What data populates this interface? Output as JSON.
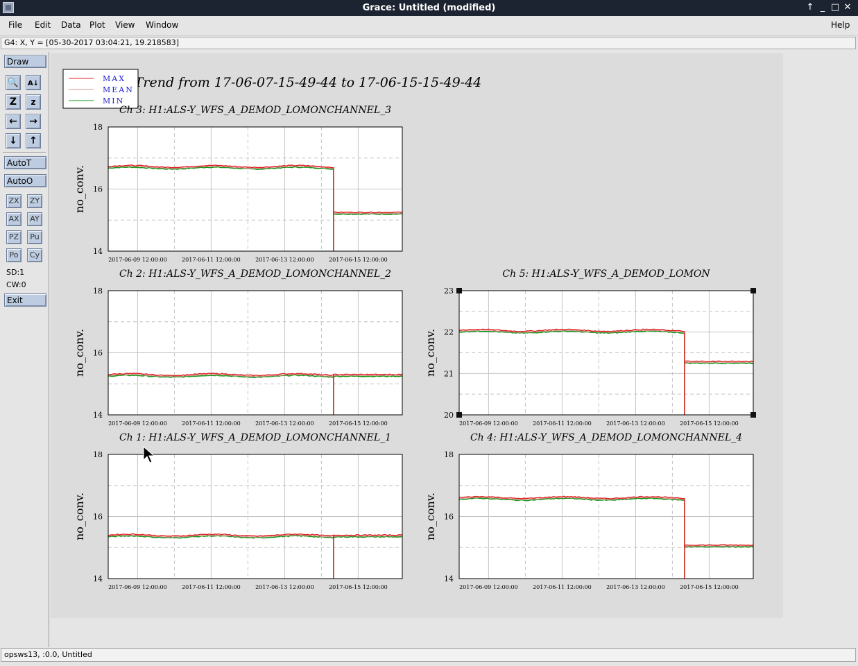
{
  "window": {
    "title": "Grace: Untitled (modified)"
  },
  "menu": {
    "items": [
      "File",
      "Edit",
      "Data",
      "Plot",
      "View",
      "Window"
    ],
    "help": "Help"
  },
  "coord_readout": "G4: X, Y = [05-30-2017 03:04:21, 19.218583]",
  "toolbar": {
    "draw": "Draw",
    "autot": "AutoT",
    "autoo": "AutoO",
    "small_buttons": [
      "ZX",
      "ZY",
      "AX",
      "AY",
      "PZ",
      "Pu",
      "Po",
      "Cy"
    ],
    "sd": "SD:1",
    "cw": "CW:0",
    "exit": "Exit"
  },
  "statusbar": "opsws13, :0.0, Untitled",
  "chart_data": {
    "type": "line",
    "title": "Trend from 17-06-07-15-49-44 to 17-06-15-15-49-44",
    "legend": {
      "placement": "top-left",
      "entries": [
        {
          "name": "MAX",
          "color": "#e02020"
        },
        {
          "name": "MEAN",
          "color": "#d89090"
        },
        {
          "name": "MIN",
          "color": "#16981a"
        }
      ]
    },
    "x_tick_labels": [
      "2017-06-09 12:00:00",
      "2017-06-11 12:00:00",
      "2017-06-13 12:00:00",
      "2017-06-15 12:00:00"
    ],
    "colors": {
      "max": "#e02020",
      "mean": "#d89090",
      "min": "#16981a",
      "grid": "#c4c4c4"
    },
    "panels": [
      {
        "id": "ch3",
        "title": "Ch 3: H1:ALS-Y_WFS_A_DEMOD_LOMONCHANNEL_3",
        "ylabel": "no_conv.",
        "ylim": [
          14,
          18
        ],
        "yticks": [
          "18",
          "16",
          "14"
        ],
        "level_before": 16.7,
        "level_after": 15.22,
        "drop": true
      },
      {
        "id": "ch2",
        "title": "Ch 2: H1:ALS-Y_WFS_A_DEMOD_LOMONCHANNEL_2",
        "ylabel": "no_conv.",
        "ylim": [
          14,
          18
        ],
        "yticks": [
          "18",
          "16",
          "14"
        ],
        "level_before": 15.27,
        "level_after": 15.27,
        "drop": true
      },
      {
        "id": "ch5",
        "title": "Ch 5: H1:ALS-Y_WFS_A_DEMOD_LOMON",
        "ylabel": "no_conv.",
        "ylim": [
          20,
          23
        ],
        "yticks": [
          "23",
          "22",
          "21",
          "20"
        ],
        "level_before": 22.02,
        "level_after": 21.27,
        "drop": true,
        "selected": true
      },
      {
        "id": "ch1",
        "title": "Ch 1: H1:ALS-Y_WFS_A_DEMOD_LOMONCHANNEL_1",
        "ylabel": "no_conv.",
        "ylim": [
          14,
          18
        ],
        "yticks": [
          "18",
          "16",
          "14"
        ],
        "level_before": 15.37,
        "level_after": 15.37,
        "drop": true
      },
      {
        "id": "ch4",
        "title": "Ch 4: H1:ALS-Y_WFS_A_DEMOD_LOMONCHANNEL_4",
        "ylabel": "no_conv.",
        "ylim": [
          14,
          18
        ],
        "yticks": [
          "18",
          "16",
          "14"
        ],
        "level_before": 16.58,
        "level_after": 15.05,
        "drop": true
      }
    ]
  }
}
